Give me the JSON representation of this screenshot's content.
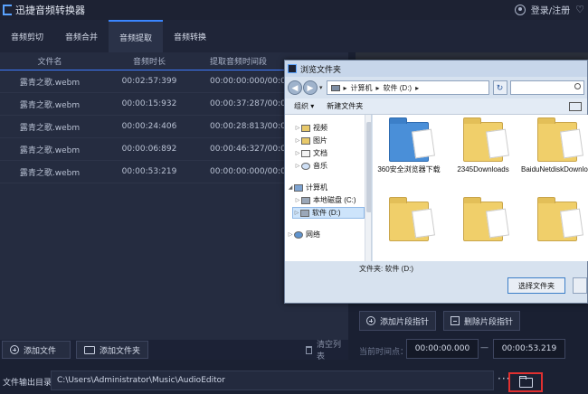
{
  "app": {
    "title": "迅捷音频转换器",
    "login_text": "登录/注册"
  },
  "tabs": [
    {
      "label": "音频剪切"
    },
    {
      "label": "音频合并"
    },
    {
      "label": "音频提取",
      "active": true
    },
    {
      "label": "音频转换"
    }
  ],
  "table": {
    "headers": [
      "文件名",
      "音频时长",
      "提取音频时间段"
    ],
    "rows": [
      {
        "name": "露青之歌.webm",
        "duration": "00:02:57:399",
        "range": "00:00:00:000/00:02:57:3"
      },
      {
        "name": "露青之歌.webm",
        "duration": "00:00:15:932",
        "range": "00:00:37:287/00:00:53:2"
      },
      {
        "name": "露青之歌.webm",
        "duration": "00:00:24:406",
        "range": "00:00:28:813/00:00:53:2"
      },
      {
        "name": "露青之歌.webm",
        "duration": "00:00:06:892",
        "range": "00:00:46:327/00:00:53:2"
      },
      {
        "name": "露青之歌.webm",
        "duration": "00:00:53:219",
        "range": "00:00:00:000/00:00:53:2"
      }
    ]
  },
  "toolbar": {
    "add_file": "添加文件",
    "add_folder": "添加文件夹",
    "clear_list": "清空列表"
  },
  "segment": {
    "add_pointer": "添加片段指针",
    "remove_pointer": "删除片段指针",
    "current_time_label": "当前时间点：",
    "start_time": "00:00:00.000",
    "dash": "—",
    "end_time": "00:00:53.219"
  },
  "output": {
    "label": "文件输出目录：",
    "path": "C:\\Users\\Administrator\\Music\\AudioEditor",
    "more": "···"
  },
  "dialog": {
    "title": "浏览文件夹",
    "breadcrumb": [
      "计算机",
      "软件 (D:)"
    ],
    "organize": "组织 ▾",
    "new_folder": "新建文件夹",
    "tree": [
      {
        "label": "视频",
        "icon": "video-folder-icon"
      },
      {
        "label": "图片",
        "icon": "pictures-folder-icon"
      },
      {
        "label": "文档",
        "icon": "documents-folder-icon"
      },
      {
        "label": "音乐",
        "icon": "music-folder-icon"
      },
      {
        "label": "计算机",
        "icon": "computer-icon"
      },
      {
        "label": "本地磁盘 (C:)",
        "icon": "drive-icon"
      },
      {
        "label": "软件 (D:)",
        "icon": "drive-icon",
        "selected": true
      },
      {
        "label": "网络",
        "icon": "network-icon"
      }
    ],
    "files": [
      {
        "label": "360安全浏览器下载",
        "icon": "blue-folder-icon"
      },
      {
        "label": "2345Downloads",
        "icon": "folder-icon"
      },
      {
        "label": "BaiduNetdiskDownload",
        "icon": "folder-icon"
      },
      {
        "label": "",
        "icon": "folder-icon"
      },
      {
        "label": "",
        "icon": "folder-icon"
      },
      {
        "label": "",
        "icon": "folder-icon"
      }
    ],
    "filename_label": "文件夹: 软件 (D:)",
    "select_button": "选择文件夹"
  }
}
